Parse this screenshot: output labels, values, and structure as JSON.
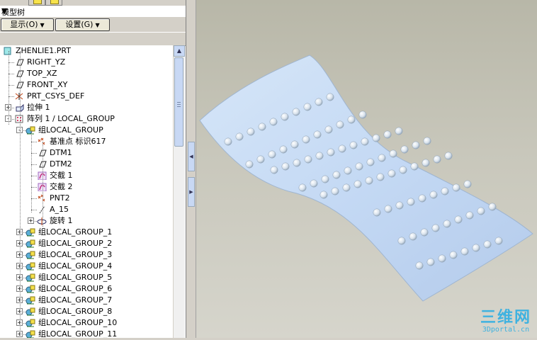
{
  "panel": {
    "title": "模型树",
    "show_button": "显示(O)",
    "settings_button": "设置(G)"
  },
  "tree": {
    "items": [
      {
        "label": "ZHENLIE1.PRT",
        "icon": "part-icon"
      },
      {
        "label": "RIGHT_YZ",
        "icon": "datum-plane-icon"
      },
      {
        "label": "TOP_XZ",
        "icon": "datum-plane-icon"
      },
      {
        "label": "FRONT_XY",
        "icon": "datum-plane-icon"
      },
      {
        "label": "PRT_CSYS_DEF",
        "icon": "csys-icon"
      },
      {
        "label": "拉伸 1",
        "icon": "extrude-icon"
      },
      {
        "label": "阵列 1 / LOCAL_GROUP",
        "icon": "pattern-icon"
      },
      {
        "label": "组LOCAL_GROUP",
        "icon": "group-icon"
      },
      {
        "label": "基准点 标识617",
        "icon": "datum-point-icon"
      },
      {
        "label": "DTM1",
        "icon": "datum-plane-icon"
      },
      {
        "label": "DTM2",
        "icon": "datum-plane-icon"
      },
      {
        "label": "交截 1",
        "icon": "intersect-icon"
      },
      {
        "label": "交截 2",
        "icon": "intersect-icon"
      },
      {
        "label": "PNT2",
        "icon": "datum-point-icon"
      },
      {
        "label": "A_15",
        "icon": "axis-icon"
      },
      {
        "label": "旋转 1",
        "icon": "revolve-icon"
      },
      {
        "label": "组LOCAL_GROUP_1",
        "icon": "group-icon"
      },
      {
        "label": "组LOCAL_GROUP_2",
        "icon": "group-icon"
      },
      {
        "label": "组LOCAL_GROUP_3",
        "icon": "group-icon"
      },
      {
        "label": "组LOCAL_GROUP_4",
        "icon": "group-icon"
      },
      {
        "label": "组LOCAL_GROUP_5",
        "icon": "group-icon"
      },
      {
        "label": "组LOCAL_GROUP_6",
        "icon": "group-icon"
      },
      {
        "label": "组LOCAL_GROUP_7",
        "icon": "group-icon"
      },
      {
        "label": "组LOCAL_GROUP_8",
        "icon": "group-icon"
      },
      {
        "label": "组LOCAL_GROUP_10",
        "icon": "group-icon"
      },
      {
        "label": "组LOCAL_GROUP_11",
        "icon": "group-icon"
      }
    ]
  },
  "watermark": {
    "brand": "三维网",
    "site": "3Dportal.cn"
  },
  "colors": {
    "surface": "#c4d9f4",
    "bump": "#e6edf4",
    "viewport_bg": "#c8c7bb",
    "watermark": "#3fb2e0"
  }
}
